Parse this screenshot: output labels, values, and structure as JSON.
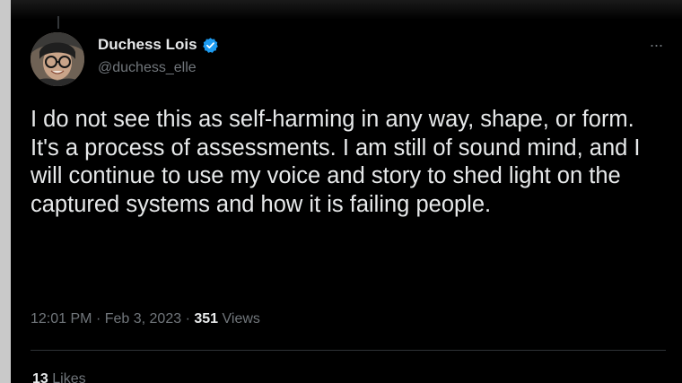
{
  "tweet": {
    "author": {
      "display_name": "Duchess Lois",
      "handle": "@duchess_elle",
      "verified": true,
      "avatar_icon": "profile-photo"
    },
    "paragraphs": [
      "I do not see this as self-harming in any way, shape, or form.",
      "It's a process of assessments. I am still of sound mind, and I will continue to use my voice and story to shed light on the captured systems and how it is failing people."
    ],
    "meta": {
      "time": "12:01 PM",
      "separator": "·",
      "date": "Feb 3, 2023",
      "views_count": "351",
      "views_label": "Views"
    },
    "stats": {
      "likes_count": "13",
      "likes_label": "Likes"
    },
    "more_label": "···"
  },
  "colors": {
    "background": "#000000",
    "text_primary": "#e7e9ea",
    "text_secondary": "#71767b",
    "verified_blue": "#1d9bf0",
    "divider": "#2f3336"
  }
}
